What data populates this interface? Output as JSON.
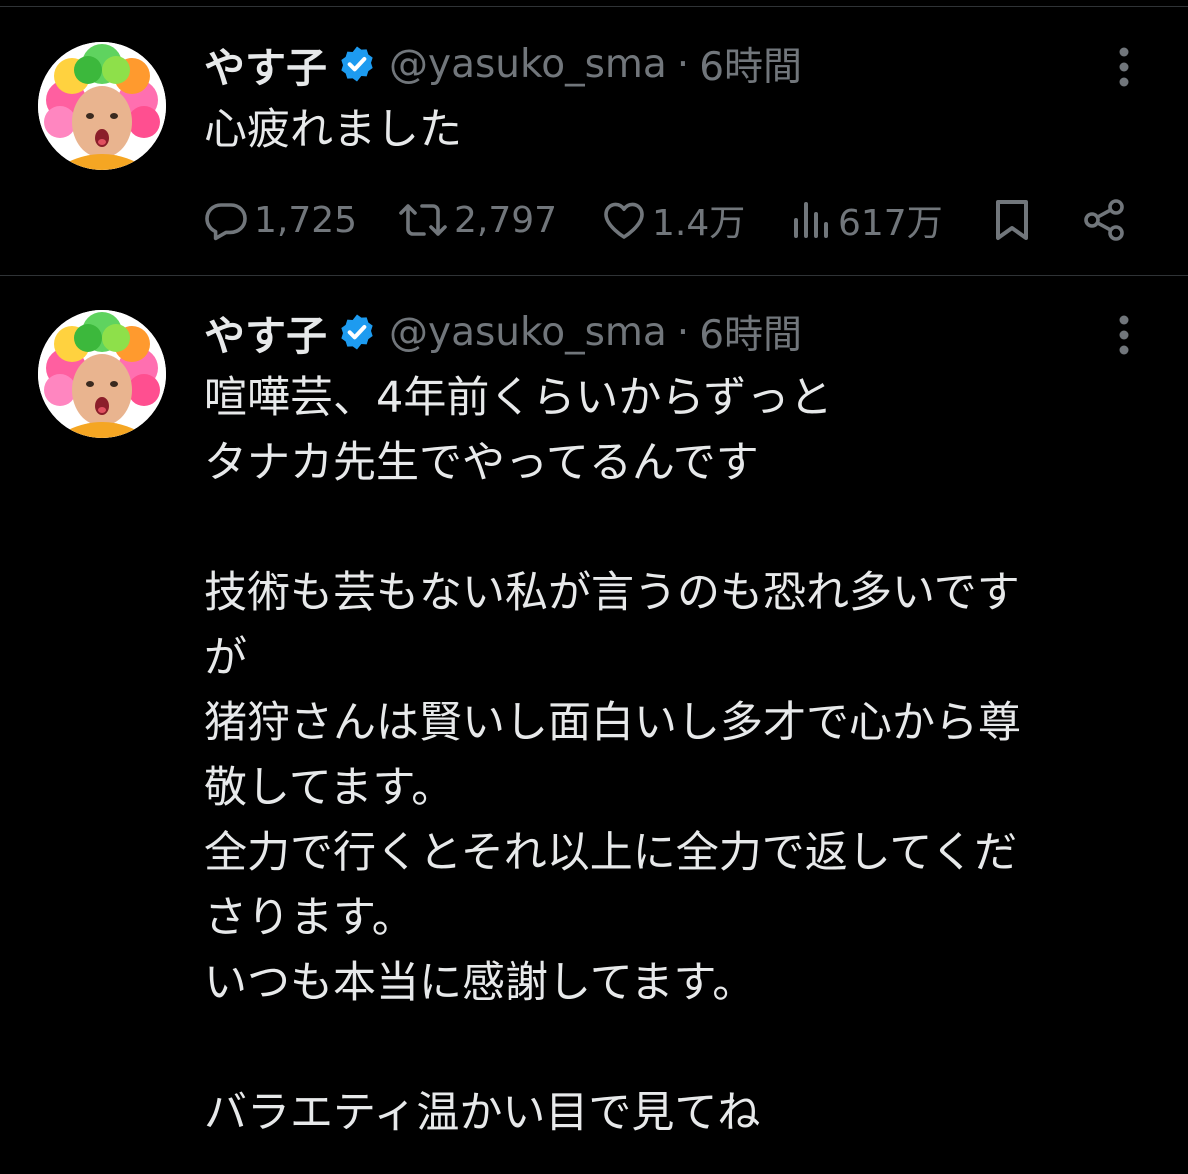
{
  "colors": {
    "background": "#000000",
    "text_primary": "#e7e9ea",
    "text_secondary": "#71767b",
    "verified_badge": "#1d9bf0",
    "divider": "#2f3336"
  },
  "tweets": [
    {
      "author_name": "やす子",
      "handle": "@yasuko_sma",
      "separator": "·",
      "time": "6時間",
      "verified_icon": "verified-badge-icon",
      "more_icon": "more-vertical-icon",
      "text_lines": [
        "心疲れました"
      ],
      "metrics": {
        "replies": "1,725",
        "reposts": "2,797",
        "likes": "1.4万",
        "views": "617万"
      },
      "action_icons": [
        "reply-icon",
        "repost-icon",
        "like-icon",
        "views-icon",
        "bookmark-icon",
        "share-icon"
      ]
    },
    {
      "author_name": "やす子",
      "handle": "@yasuko_sma",
      "separator": "·",
      "time": "6時間",
      "verified_icon": "verified-badge-icon",
      "more_icon": "more-vertical-icon",
      "text_lines": [
        "喧嘩芸、4年前くらいからずっと",
        "タナカ先生でやってるんです",
        "",
        "技術も芸もない私が言うのも恐れ多いです",
        "が",
        "猪狩さんは賢いし面白いし多才で心から尊",
        "敬してます。",
        "全力で行くとそれ以上に全力で返してくだ",
        "さります。",
        "いつも本当に感謝してます。",
        "",
        "バラエティ温かい目で見てね"
      ]
    }
  ]
}
